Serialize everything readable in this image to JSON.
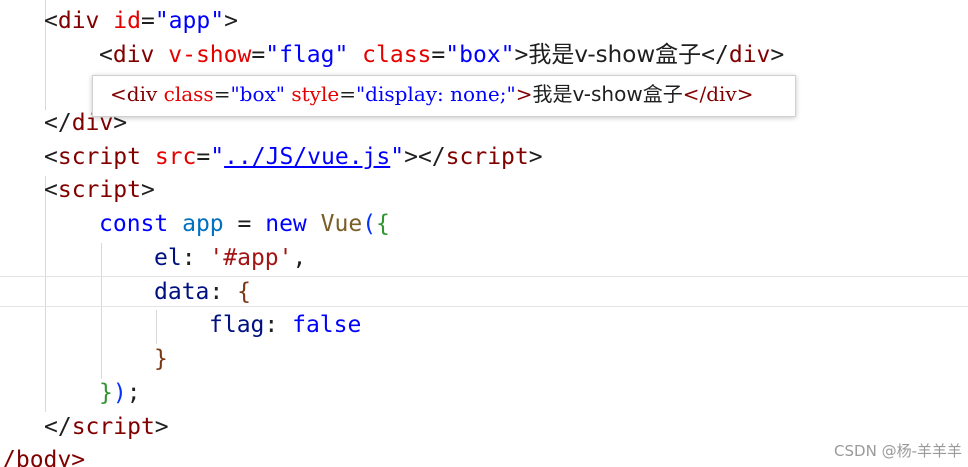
{
  "code": {
    "line1": {
      "open": "<",
      "tag": "div",
      "attr": "id",
      "eq": "=",
      "val": "\"app\"",
      "close": ">"
    },
    "line2": {
      "open": "<",
      "tag": "div",
      "attr1": "v-show",
      "eq1": "=",
      "val1": "\"flag\"",
      "attr2": "class",
      "eq2": "=",
      "val2": "\"box\"",
      "gt": ">",
      "text": "我是v-show盒子",
      "end_open": "</",
      "end_tag": "div",
      "end_close": ">"
    },
    "line3": {
      "open": "</",
      "tag": "div",
      "close": ">"
    },
    "line4": {
      "open": "<",
      "tag": "script",
      "attr": "src",
      "eq": "=",
      "q1": "\"",
      "link": "../JS/vue.js",
      "q2": "\"",
      "close": "></",
      "tag2": "script",
      "close2": ">"
    },
    "line5": {
      "open": "<",
      "tag": "script",
      "close": ">"
    },
    "line6": {
      "kw1": "const",
      "var": "app",
      "eq": "=",
      "kw2": "new",
      "cls": "Vue",
      "paren": "(",
      "brace": "{"
    },
    "line7": {
      "prop": "el",
      "colon": ":",
      "val": "'#app'",
      "comma": ","
    },
    "line8": {
      "prop": "data",
      "colon": ":",
      "brace": "{"
    },
    "line9": {
      "prop": "flag",
      "colon": ":",
      "val": "false"
    },
    "line10": {
      "brace": "}"
    },
    "line11": {
      "brace": "}",
      "paren": ")",
      "semi": ";"
    },
    "line12": {
      "open": "</",
      "tag": "script",
      "close": ">"
    },
    "line13": {
      "text": "/body>"
    }
  },
  "hover_popup": {
    "open": "<",
    "tag": "div",
    "attr1": "class",
    "eq1": "=",
    "val1": "\"box\"",
    "attr2": "style",
    "eq2": "=",
    "val2": "\"display: none;\"",
    "gt": ">",
    "text": "我是v-show盒子",
    "end_open": "</",
    "end_tag": "div",
    "end_close": ">"
  },
  "watermark": "CSDN @杨-羊羊羊",
  "colors": {
    "tag": "#800000",
    "attribute": "#e50000",
    "string": "#0000ff",
    "keyword": "#0000ff",
    "variable": "#0070c1",
    "class_name": "#795e26",
    "property": "#001080",
    "single_quote_string": "#a31515"
  }
}
